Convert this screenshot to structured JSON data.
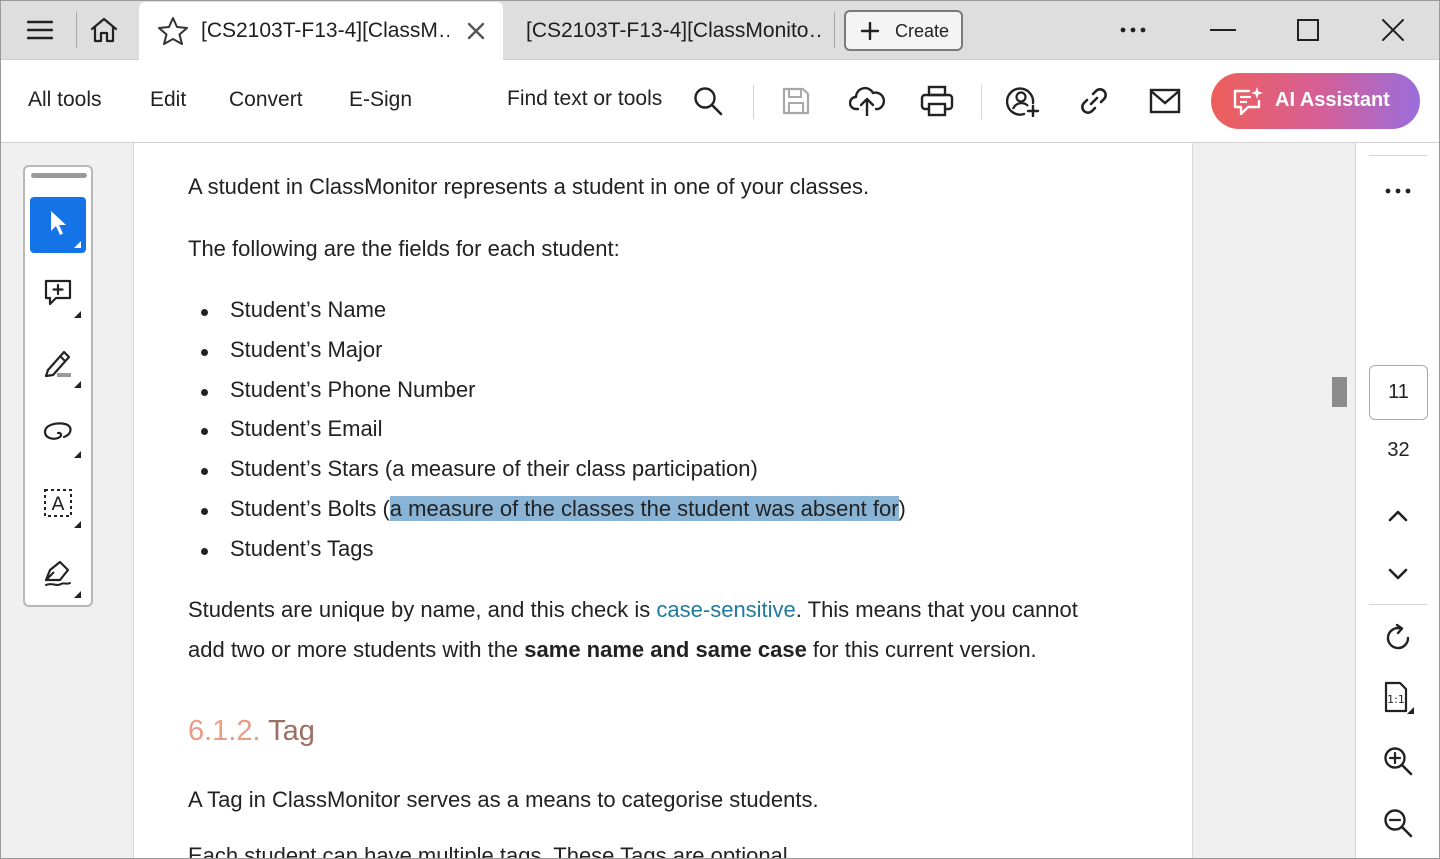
{
  "tabs": [
    {
      "label": "[CS2103T-F13-4][ClassM…",
      "active": true
    },
    {
      "label": "[CS2103T-F13-4][ClassMonito…",
      "active": false
    }
  ],
  "create_label": "Create",
  "toolbar": {
    "menu": [
      "All tools",
      "Edit",
      "Convert",
      "E-Sign"
    ],
    "find_label": "Find text or tools",
    "ai_label": "AI Assistant"
  },
  "document": {
    "intro": "A student in ClassMonitor represents a student in one of your classes.",
    "fields_intro": "The following are the fields for each student:",
    "fields": [
      "Student’s Name",
      "Student’s Major",
      "Student’s Phone Number",
      "Student’s Email",
      "Student’s Stars (a measure of their class participation)"
    ],
    "bolts_prefix": "Student’s Bolts (",
    "bolts_highlight": "a measure of the classes the student was absent for",
    "bolts_suffix": ")",
    "tags_field": "Student’s Tags",
    "unique_part1": "Students are unique by name, and this check is ",
    "unique_link": "case-sensitive",
    "unique_part2": ". This means that you cannot",
    "unique_line2_part1": "add two or more students with the ",
    "unique_line2_bold": "same name and same case",
    "unique_line2_part2": " for this current version.",
    "heading_number": "6.1.2.",
    "heading_title": "Tag",
    "tag_intro": "A Tag in ClassMonitor serves as a means to categorise students.",
    "cut_line": "Each student can have multiple tags. These Tags are optional."
  },
  "pager": {
    "current_page": "11",
    "total_pages": "32"
  }
}
